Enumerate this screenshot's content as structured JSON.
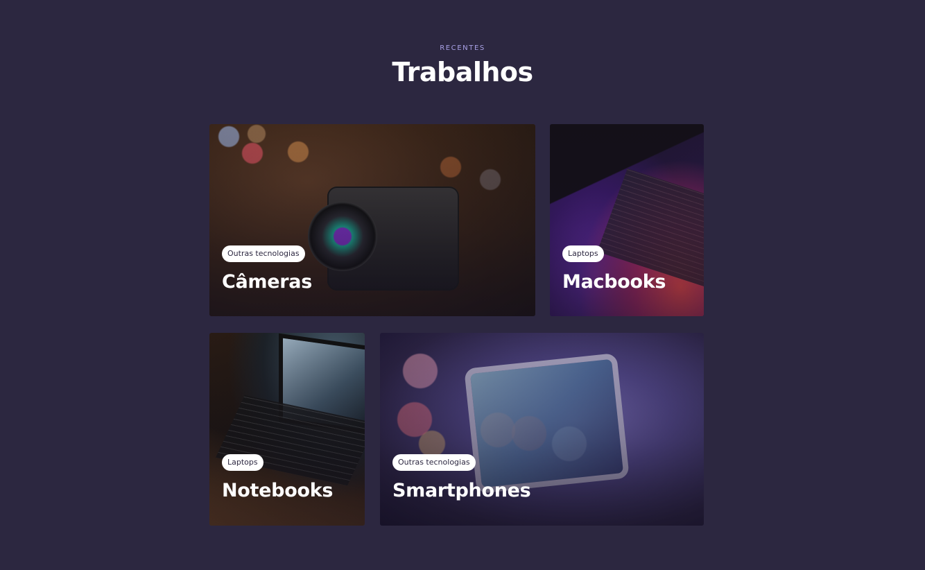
{
  "header": {
    "eyebrow": "RECENTES",
    "title": "Trabalhos"
  },
  "cards": [
    {
      "tag": "Outras tecnologias",
      "title": "Câmeras"
    },
    {
      "tag": "Laptops",
      "title": "Macbooks"
    },
    {
      "tag": "Laptops",
      "title": "Notebooks"
    },
    {
      "tag": "Outras tecnologias",
      "title": "Smartphones"
    }
  ],
  "colors": {
    "background": "#2c2740",
    "eyebrow": "#a9a1e6",
    "title": "#ffffff",
    "tag_bg": "#ffffff",
    "tag_text": "#2c2740"
  }
}
